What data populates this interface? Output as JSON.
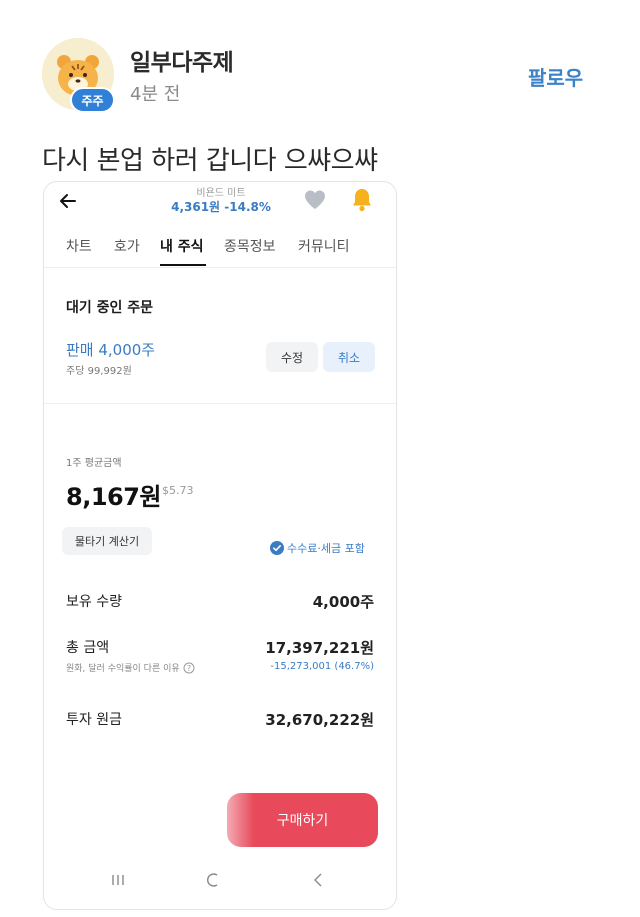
{
  "post": {
    "username": "일부다주제",
    "time": "4분 전",
    "badge": "주주",
    "follow_label": "팔로우",
    "text": "다시 본업 하러 갑니다 으쌰으쌰"
  },
  "screenshot": {
    "header": {
      "stock_name": "비욘드 미트",
      "price_change": "4,361원 -14.8%"
    },
    "tabs": [
      {
        "label": "차트",
        "active": false
      },
      {
        "label": "호가",
        "active": false
      },
      {
        "label": "내 주식",
        "active": true
      },
      {
        "label": "종목정보",
        "active": false
      },
      {
        "label": "커뮤니티",
        "active": false
      }
    ],
    "pending": {
      "title": "대기 중인 주문",
      "order_label": "판매 4,000주",
      "order_sub": "주당 99,992원",
      "edit_label": "수정",
      "cancel_label": "취소"
    },
    "average": {
      "label": "1주 평균금액",
      "value": "8,167원",
      "usd": "$5.73",
      "calc_button": "물타기 계산기",
      "fee_note": "수수료·세금 포함"
    },
    "rows": {
      "holding_label": "보유 수량",
      "holding_value": "4,000주",
      "total_label": "총 금액",
      "total_value": "17,397,221원",
      "total_sub": "원화, 달러 수익률이 다른 이유",
      "total_change": "-15,273,001 (46.7%)",
      "principal_label": "투자 원금",
      "principal_value": "32,670,222원"
    },
    "buy_button": "구매하기"
  },
  "colors": {
    "accent_blue": "#3a7cc4",
    "buy_red": "#e8495b",
    "badge_blue": "#2f80d6"
  },
  "icons": [
    "tiger-avatar",
    "back-arrow-icon",
    "heart-icon",
    "bell-icon",
    "check-icon",
    "info-icon",
    "recent-apps-icon",
    "home-icon",
    "back-nav-icon"
  ]
}
